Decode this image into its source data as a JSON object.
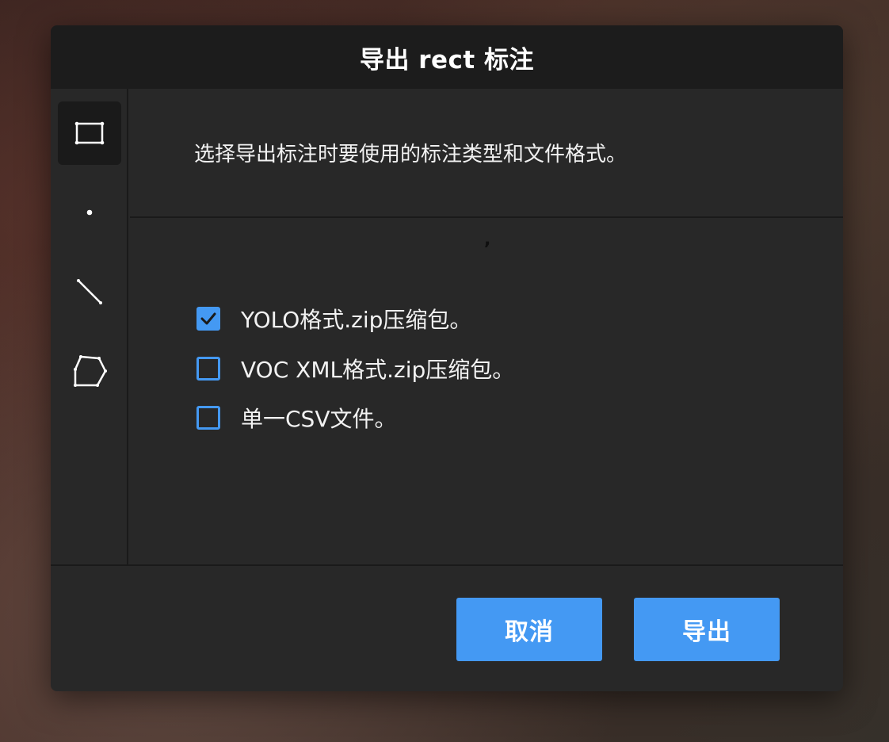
{
  "dialog": {
    "title": "导出 rect 标注",
    "intro": "选择导出标注时要使用的标注类型和文件格式。",
    "stray_mark": ","
  },
  "tools": [
    {
      "name": "rectangle",
      "icon": "rectangle-icon",
      "active": true
    },
    {
      "name": "point",
      "icon": "point-icon",
      "active": false
    },
    {
      "name": "line",
      "icon": "line-icon",
      "active": false
    },
    {
      "name": "polygon",
      "icon": "polygon-icon",
      "active": false
    }
  ],
  "options": [
    {
      "label": "YOLO格式.zip压缩包。",
      "checked": true
    },
    {
      "label": "VOC XML格式.zip压缩包。",
      "checked": false
    },
    {
      "label": "单一CSV文件。",
      "checked": false
    }
  ],
  "footer": {
    "cancel_label": "取消",
    "export_label": "导出"
  },
  "colors": {
    "accent": "#4499f3",
    "dialog_bg": "#282828",
    "header_bg": "#1c1c1c"
  }
}
